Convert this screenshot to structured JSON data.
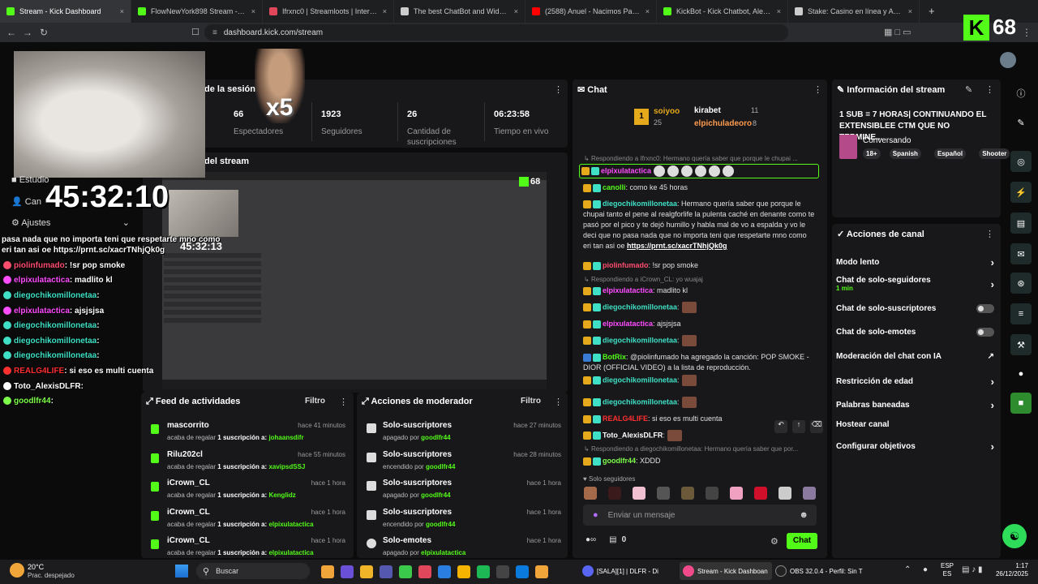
{
  "browser": {
    "tabs": [
      {
        "label": "Stream - Kick Dashboard",
        "color": "#53fc18",
        "active": true
      },
      {
        "label": "FlowNewYork898 Stream - Watch Li",
        "color": "#53fc18"
      },
      {
        "label": "Ifrxnc0 | Streamloots | Interacciones",
        "color": "#e0475b"
      },
      {
        "label": "The best ChatBot and Widgets for K",
        "color": "#cccccc"
      },
      {
        "label": "(2588) Anuel - Nacimos Pa Morir (Of",
        "color": "#ff0000"
      },
      {
        "label": "KickBot - Kick Chatbot, Alerts, TTS, O",
        "color": "#53fc18"
      },
      {
        "label": "Stake: Casino en línea y Apuestas De",
        "color": "#cccccc"
      }
    ],
    "new_tab": "+",
    "url": "dashboard.kick.com/stream",
    "kick_badge": "K",
    "kick_count": "68"
  },
  "session": {
    "title": "de la sesión",
    "stats": [
      {
        "value": "66",
        "label": "Espectadores"
      },
      {
        "value": "1923",
        "label": "Seguidores"
      },
      {
        "value": "26",
        "label": "Cantidad de suscripciones"
      },
      {
        "value": "06:23:58",
        "label": "Tiempo en vivo"
      }
    ]
  },
  "preview": {
    "title": "del stream",
    "inner_timer": "45:32:13",
    "inner_count": "68"
  },
  "overlay": {
    "timer": "45:32:10",
    "multiplier": "x5",
    "menu": [
      "Estudio",
      "Can",
      "Ajustes"
    ],
    "chat_lines": [
      {
        "user": "",
        "text": "pasa nada que no importa teni que respetarte mno como eri tan asi oe https://prnt.sc/xacrTNhjQk0g",
        "color": "#ffffff"
      },
      {
        "user": "piolinfumado",
        "text": ": !sr pop smoke",
        "color": "#ff4d6d"
      },
      {
        "user": "elpixulatactica",
        "text": ": madlito kl",
        "color": "#ff4dff"
      },
      {
        "user": "diegochikomillonetaa",
        "text": ": ",
        "color": "#3fe0c5"
      },
      {
        "user": "elpixulatactica",
        "text": ": ajsjsjsa",
        "color": "#ff4dff"
      },
      {
        "user": "diegochikomillonetaa",
        "text": ": ",
        "color": "#3fe0c5"
      },
      {
        "user": "diegochikomillonetaa",
        "text": ": ",
        "color": "#3fe0c5"
      },
      {
        "user": "diegochikomillonetaa",
        "text": ": ",
        "color": "#3fe0c5"
      },
      {
        "user": "REALG4LIFE",
        "text": ": si eso es multi cuenta",
        "color": "#ff3030"
      },
      {
        "user": "Toto_AlexisDLFR",
        "text": ": ",
        "color": "#ffffff"
      },
      {
        "user": "goodlfr44",
        "text": ": ",
        "color": "#7dff4a"
      }
    ]
  },
  "activity": {
    "title": "Feed de actividades",
    "filter": "Filtro",
    "items": [
      {
        "name": "mascorrito",
        "desc": "acaba de regalar",
        "bold": "1 suscripción a:",
        "target": "johaansdifr",
        "time": "hace 41 minutos"
      },
      {
        "name": "Rilu202cl",
        "desc": "acaba de regalar",
        "bold": "1 suscripción a:",
        "target": "xavipsdSSJ",
        "time": "hace 55 minutos"
      },
      {
        "name": "iCrown_CL",
        "desc": "acaba de regalar",
        "bold": "1 suscripción a:",
        "target": "Kenglidz",
        "time": "hace 1 hora"
      },
      {
        "name": "iCrown_CL",
        "desc": "acaba de regalar",
        "bold": "1 suscripción a:",
        "target": "elpixulatactica",
        "time": "hace 1 hora"
      },
      {
        "name": "iCrown_CL",
        "desc": "acaba de regalar",
        "bold": "1 suscripción a:",
        "target": "elpixulatactica",
        "time": "hace 1 hora"
      }
    ]
  },
  "modactions": {
    "title": "Acciones de moderador",
    "filter": "Filtro",
    "items": [
      {
        "name": "Solo-suscriptores",
        "state": "apagado por",
        "by": "goodlfr44",
        "time": "hace 27 minutos"
      },
      {
        "name": "Solo-suscriptores",
        "state": "encendido por",
        "by": "goodlfr44",
        "time": "hace 28 minutos"
      },
      {
        "name": "Solo-suscriptores",
        "state": "apagado por",
        "by": "goodlfr44",
        "time": "hace 1 hora"
      },
      {
        "name": "Solo-suscriptores",
        "state": "encendido por",
        "by": "goodlfr44",
        "time": "hace 1 hora"
      },
      {
        "name": "Solo-emotes",
        "state": "apagado por",
        "by": "elpixulatactica",
        "time": "hace 1 hora"
      }
    ]
  },
  "chat": {
    "title": "Chat",
    "leaderboard": {
      "first": "soiyoo",
      "first_count": "25",
      "second": "kirabet",
      "second_count": "11",
      "third": "elpichuladeoro",
      "third_count": "8",
      "rank": "1"
    },
    "messages": [
      {
        "kind": "reply",
        "text": "Respondiendo a Ifrxnc0: Hermano quería saber que porque le chupai ..."
      },
      {
        "kind": "msg",
        "user": "elpixulatactica",
        "color": "#ff4dff",
        "text": "",
        "emotes": 6,
        "highlight": true
      },
      {
        "kind": "msg",
        "user": "canolli",
        "color": "#53fc18",
        "text": ": como ke 45 horas"
      },
      {
        "kind": "msg",
        "user": "diegochikomillonetaa",
        "color": "#3fe0c5",
        "text": ": Hermano quería saber que porque le chupai tanto el pene al realgforlife la pulenta caché en denante como te pasó por el pico y te dejó humillo y habla mal de vo a espalda y vo le deci que no pasa nada que no importa teni que respetarte mno como eri tan asi oe ",
        "link": "https://prnt.sc/xacrTNhjQk0g"
      },
      {
        "kind": "msg",
        "user": "piolinfumado",
        "color": "#ff4d6d",
        "text": ": !sr pop smoke"
      },
      {
        "kind": "reply",
        "text": "Respondiendo a iCrown_CL: yo wuajaj"
      },
      {
        "kind": "msg",
        "user": "elpixulatactica",
        "color": "#ff4dff",
        "text": ": madlito kl"
      },
      {
        "kind": "msg",
        "user": "diegochikomillonetaa",
        "color": "#3fe0c5",
        "text": ":",
        "emotes": 1
      },
      {
        "kind": "msg",
        "user": "elpixulatactica",
        "color": "#ff4dff",
        "text": ": ajsjsjsa"
      },
      {
        "kind": "msg",
        "user": "diegochikomillonetaa",
        "color": "#3fe0c5",
        "text": ":",
        "emotes": 1
      },
      {
        "kind": "msg",
        "user": "BotRix",
        "color": "#53fc18",
        "text": ": @piolinfumado ha agregado la canción: POP SMOKE - DIOR (OFFICIAL VIDEO) a la lista de reproducción."
      },
      {
        "kind": "msg",
        "user": "diegochikomillonetaa",
        "color": "#3fe0c5",
        "text": ":",
        "emotes": 1
      },
      {
        "kind": "msg",
        "user": "diegochikomillonetaa",
        "color": "#3fe0c5",
        "text": ":",
        "emotes": 1
      },
      {
        "kind": "msg",
        "user": "REALG4LIFE",
        "color": "#ff3030",
        "text": ": si eso es multi cuenta"
      },
      {
        "kind": "msg",
        "user": "Toto_AlexisDLFR",
        "color": "#ffffff",
        "text": ":",
        "emotes": 1
      },
      {
        "kind": "reply",
        "text": "Respondiendo a diegochikomillonetaa: Hermano quería saber que por..."
      },
      {
        "kind": "msg",
        "user": "goodlfr44",
        "color": "#7dff4a",
        "text": ": XDDD"
      }
    ],
    "followers_only_label": "Solo seguidores",
    "input_placeholder": "Enviar un mensaje",
    "footer_count": "0",
    "send_label": "Chat"
  },
  "info": {
    "title": "Información del stream",
    "stream_title": "1 SUB = 7 HORAS| CONTINUANDO EL EXTENSIBLEE CTM QUE NO TERMINE...",
    "category": "Conversando",
    "tags": [
      "18+",
      "Spanish",
      "Español",
      "Shooter"
    ]
  },
  "channel_actions": {
    "title": "Acciones de canal",
    "items": [
      {
        "label": "Modo lento",
        "control": "chevron"
      },
      {
        "label": "Chat de solo-seguidores",
        "sub": "1 min",
        "control": "chevron"
      },
      {
        "label": "Chat de solo-suscriptores",
        "control": "toggle"
      },
      {
        "label": "Chat de solo-emotes",
        "control": "toggle"
      },
      {
        "label": "Moderación del chat con IA",
        "control": "external"
      },
      {
        "label": "Restricción de edad",
        "control": "chevron"
      },
      {
        "label": "Palabras baneadas",
        "control": "chevron"
      },
      {
        "label": "Hostear canal",
        "control": "none"
      },
      {
        "label": "Configurar objetivos",
        "control": "chevron"
      }
    ]
  },
  "taskbar": {
    "weather_temp": "20°C",
    "weather_desc": "Prac. despejado",
    "search": "Buscar",
    "apps": [
      {
        "label": "[SALA][1] | DLFR - Di"
      },
      {
        "label": "Stream - Kick Dashboan"
      },
      {
        "label": "OBS 32.0.4 - Perfil: Sin T"
      }
    ],
    "lang_top": "ESP",
    "lang_bottom": "ES",
    "time": "1:17",
    "date": "26/12/2025"
  },
  "colors": {
    "accent": "#53fc18",
    "panel": "#18181b",
    "bg": "#0b0b0c"
  }
}
